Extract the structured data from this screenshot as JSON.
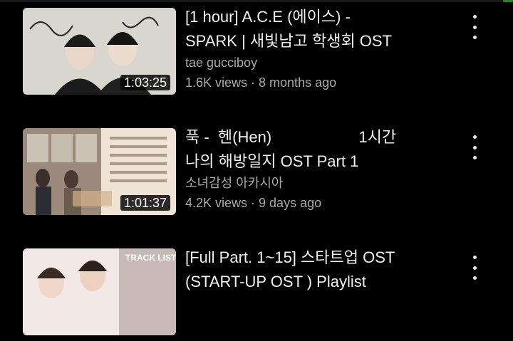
{
  "colors": {
    "background": "#000000",
    "secondary_text": "#aaaaaa"
  },
  "videos": [
    {
      "title_line1": "[1 hour] A.C.E (에이스) -",
      "title_line2": "SPARK | 새빛남고 학생회 OST",
      "channel": "tae gucciboy",
      "stats": "1.6K views · 8 months ago",
      "duration": "1:03:25",
      "more_icon": "more-vert-icon"
    },
    {
      "title_line1": "푹 -  헨(Hen)                    1시간",
      "title_line2": "나의 해방일지 OST Part 1",
      "channel": "소녀감성 아카시아",
      "stats": "4.2K views · 9 days ago",
      "duration": "1:01:37",
      "more_icon": "more-vert-icon"
    },
    {
      "title_line1": "[Full Part. 1~15] 스타트업 OST",
      "title_line2": "(START-UP OST ) Playlist",
      "thumbnail_text": "TRACK LIST",
      "more_icon": "more-vert-icon"
    }
  ]
}
